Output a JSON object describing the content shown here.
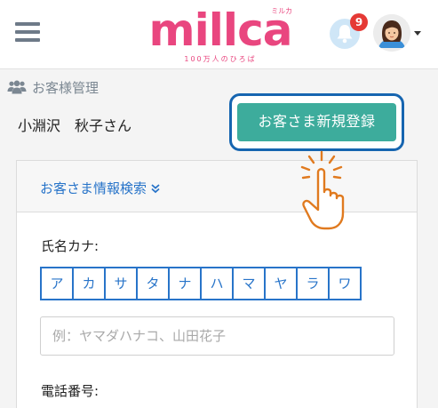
{
  "header": {
    "logo_text": "millca",
    "logo_small": "ミルカ",
    "logo_tagline": "100万人のひろば",
    "notification_count": "9"
  },
  "section": {
    "title": "お客様管理",
    "icon": "users-icon"
  },
  "user": {
    "name": "小淵沢　秋子さん"
  },
  "actions": {
    "register_label": "お客さま新規登録",
    "highlight_color": "#1665b0",
    "button_color": "#3dac9c"
  },
  "search": {
    "toggle_label": "お客さま情報検索",
    "kana_label": "氏名カナ:",
    "kana_buttons": [
      "ア",
      "カ",
      "サ",
      "タ",
      "ナ",
      "ハ",
      "マ",
      "ヤ",
      "ラ",
      "ワ"
    ],
    "name_placeholder": "例：ヤマダハナコ、山田花子",
    "name_value": "",
    "phone_label": "電話番号:"
  },
  "colors": {
    "brand": "#e9467f",
    "link": "#2874c9",
    "badge": "#e53935"
  }
}
